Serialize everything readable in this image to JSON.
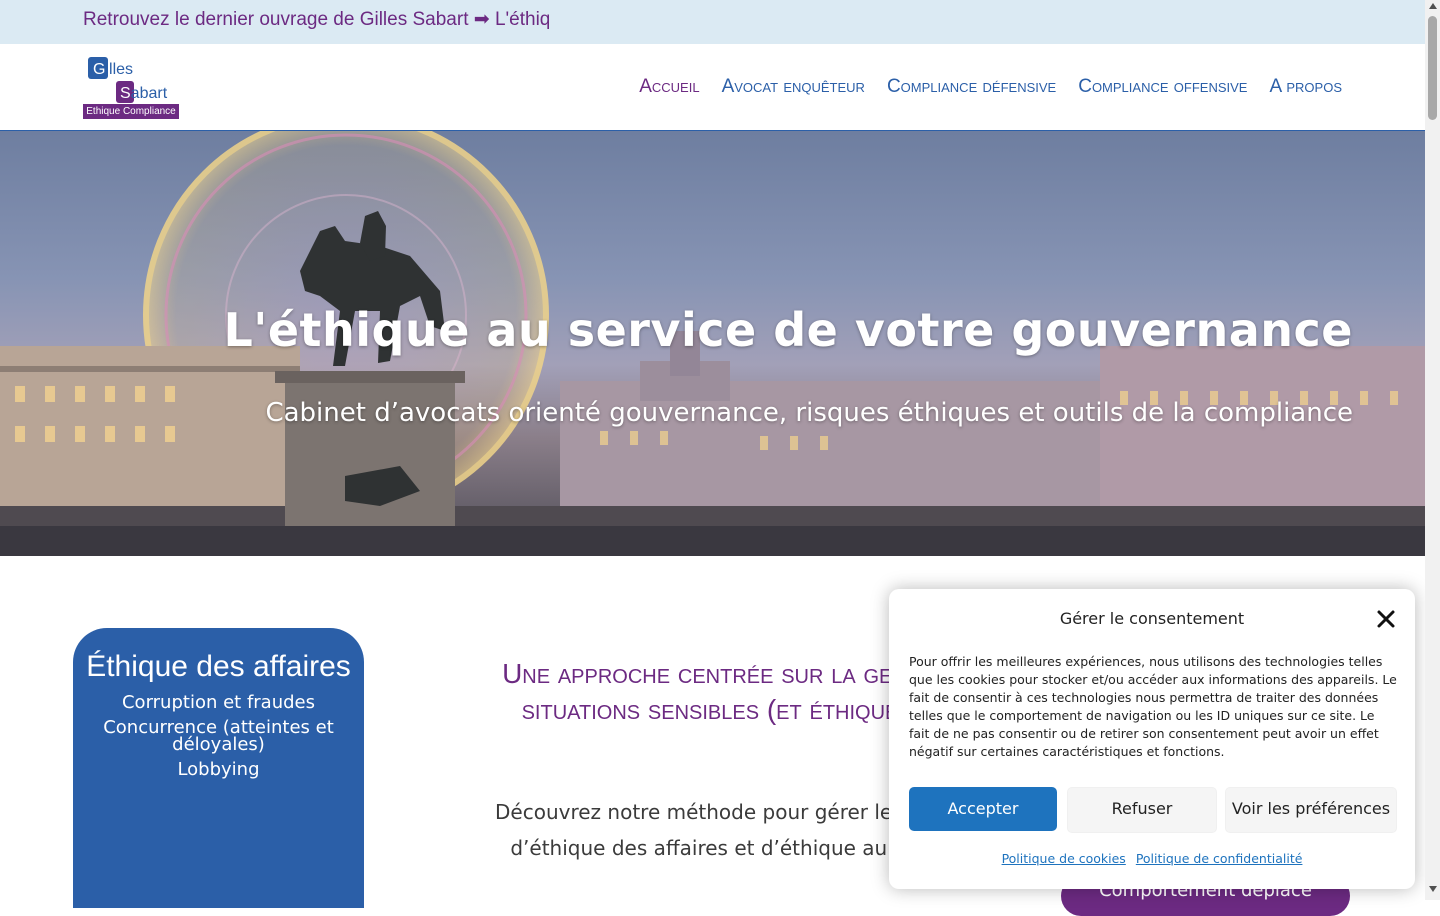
{
  "topbar": {
    "text": "Retrouvez le dernier ouvrage de Gilles Sabart ➡ L'éthiq"
  },
  "logo": {
    "line1_initial": "G",
    "line1_rest": "illes",
    "line2_initial": "S",
    "line2_rest": "abart",
    "tagline": "Ethique Compliance"
  },
  "nav": {
    "items": [
      {
        "label": "Accueil"
      },
      {
        "label": "Avocat enquêteur"
      },
      {
        "label": "Compliance défensive"
      },
      {
        "label": "Compliance offensive"
      },
      {
        "label": "A propos"
      }
    ]
  },
  "hero": {
    "title": "L'éthique au service de votre gouvernance",
    "subtitle": "Cabinet d’avocats orienté gouvernance, risques éthiques et outils de la compliance"
  },
  "card": {
    "title": "Éthique des affaires",
    "items": [
      "Corruption et fraudes",
      "Concurrence (atteintes et déloyales)",
      "Lobbying"
    ]
  },
  "main": {
    "section_title_line1": "Une approche centrée sur la gest",
    "section_title_line2": "situations sensibles (et éthique",
    "intro_line1": "Découvrez notre méthode pour gérer les si",
    "intro_line2": "d’éthique des affaires et d’éthique au tr",
    "pill": "Comportement déplacé"
  },
  "consent": {
    "title": "Gérer le consentement",
    "text": "Pour offrir les meilleures expériences, nous utilisons des technologies telles que les cookies pour stocker et/ou accéder aux informations des appareils. Le fait de consentir à ces technologies nous permettra de traiter des données telles que le comportement de navigation ou les ID uniques sur ce site. Le fait de ne pas consentir ou de retirer son consentement peut avoir un effet négatif sur certaines caractéristiques et fonctions.",
    "accept": "Accepter",
    "refuse": "Refuser",
    "preferences": "Voir les préférences",
    "link_cookies": "Politique de cookies",
    "link_privacy": "Politique de confidentialité"
  },
  "colors": {
    "brand_blue": "#2b5fa8",
    "brand_purple": "#6c2a82",
    "accept_blue": "#1e73be",
    "topbar_bg": "#dbeaf3"
  }
}
